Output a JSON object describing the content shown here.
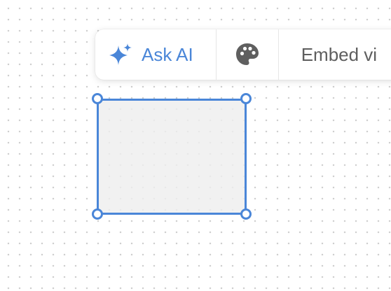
{
  "toolbar": {
    "ask_ai_label": "Ask AI",
    "embed_label": "Embed vi",
    "icons": {
      "ask_ai": "sparkle-icon",
      "style": "palette-icon"
    }
  },
  "colors": {
    "accent": "#4a86d8",
    "text_muted": "#5e5e5e",
    "palette_icon": "#5f5f5f",
    "shape_fill": "#eeeeee"
  }
}
